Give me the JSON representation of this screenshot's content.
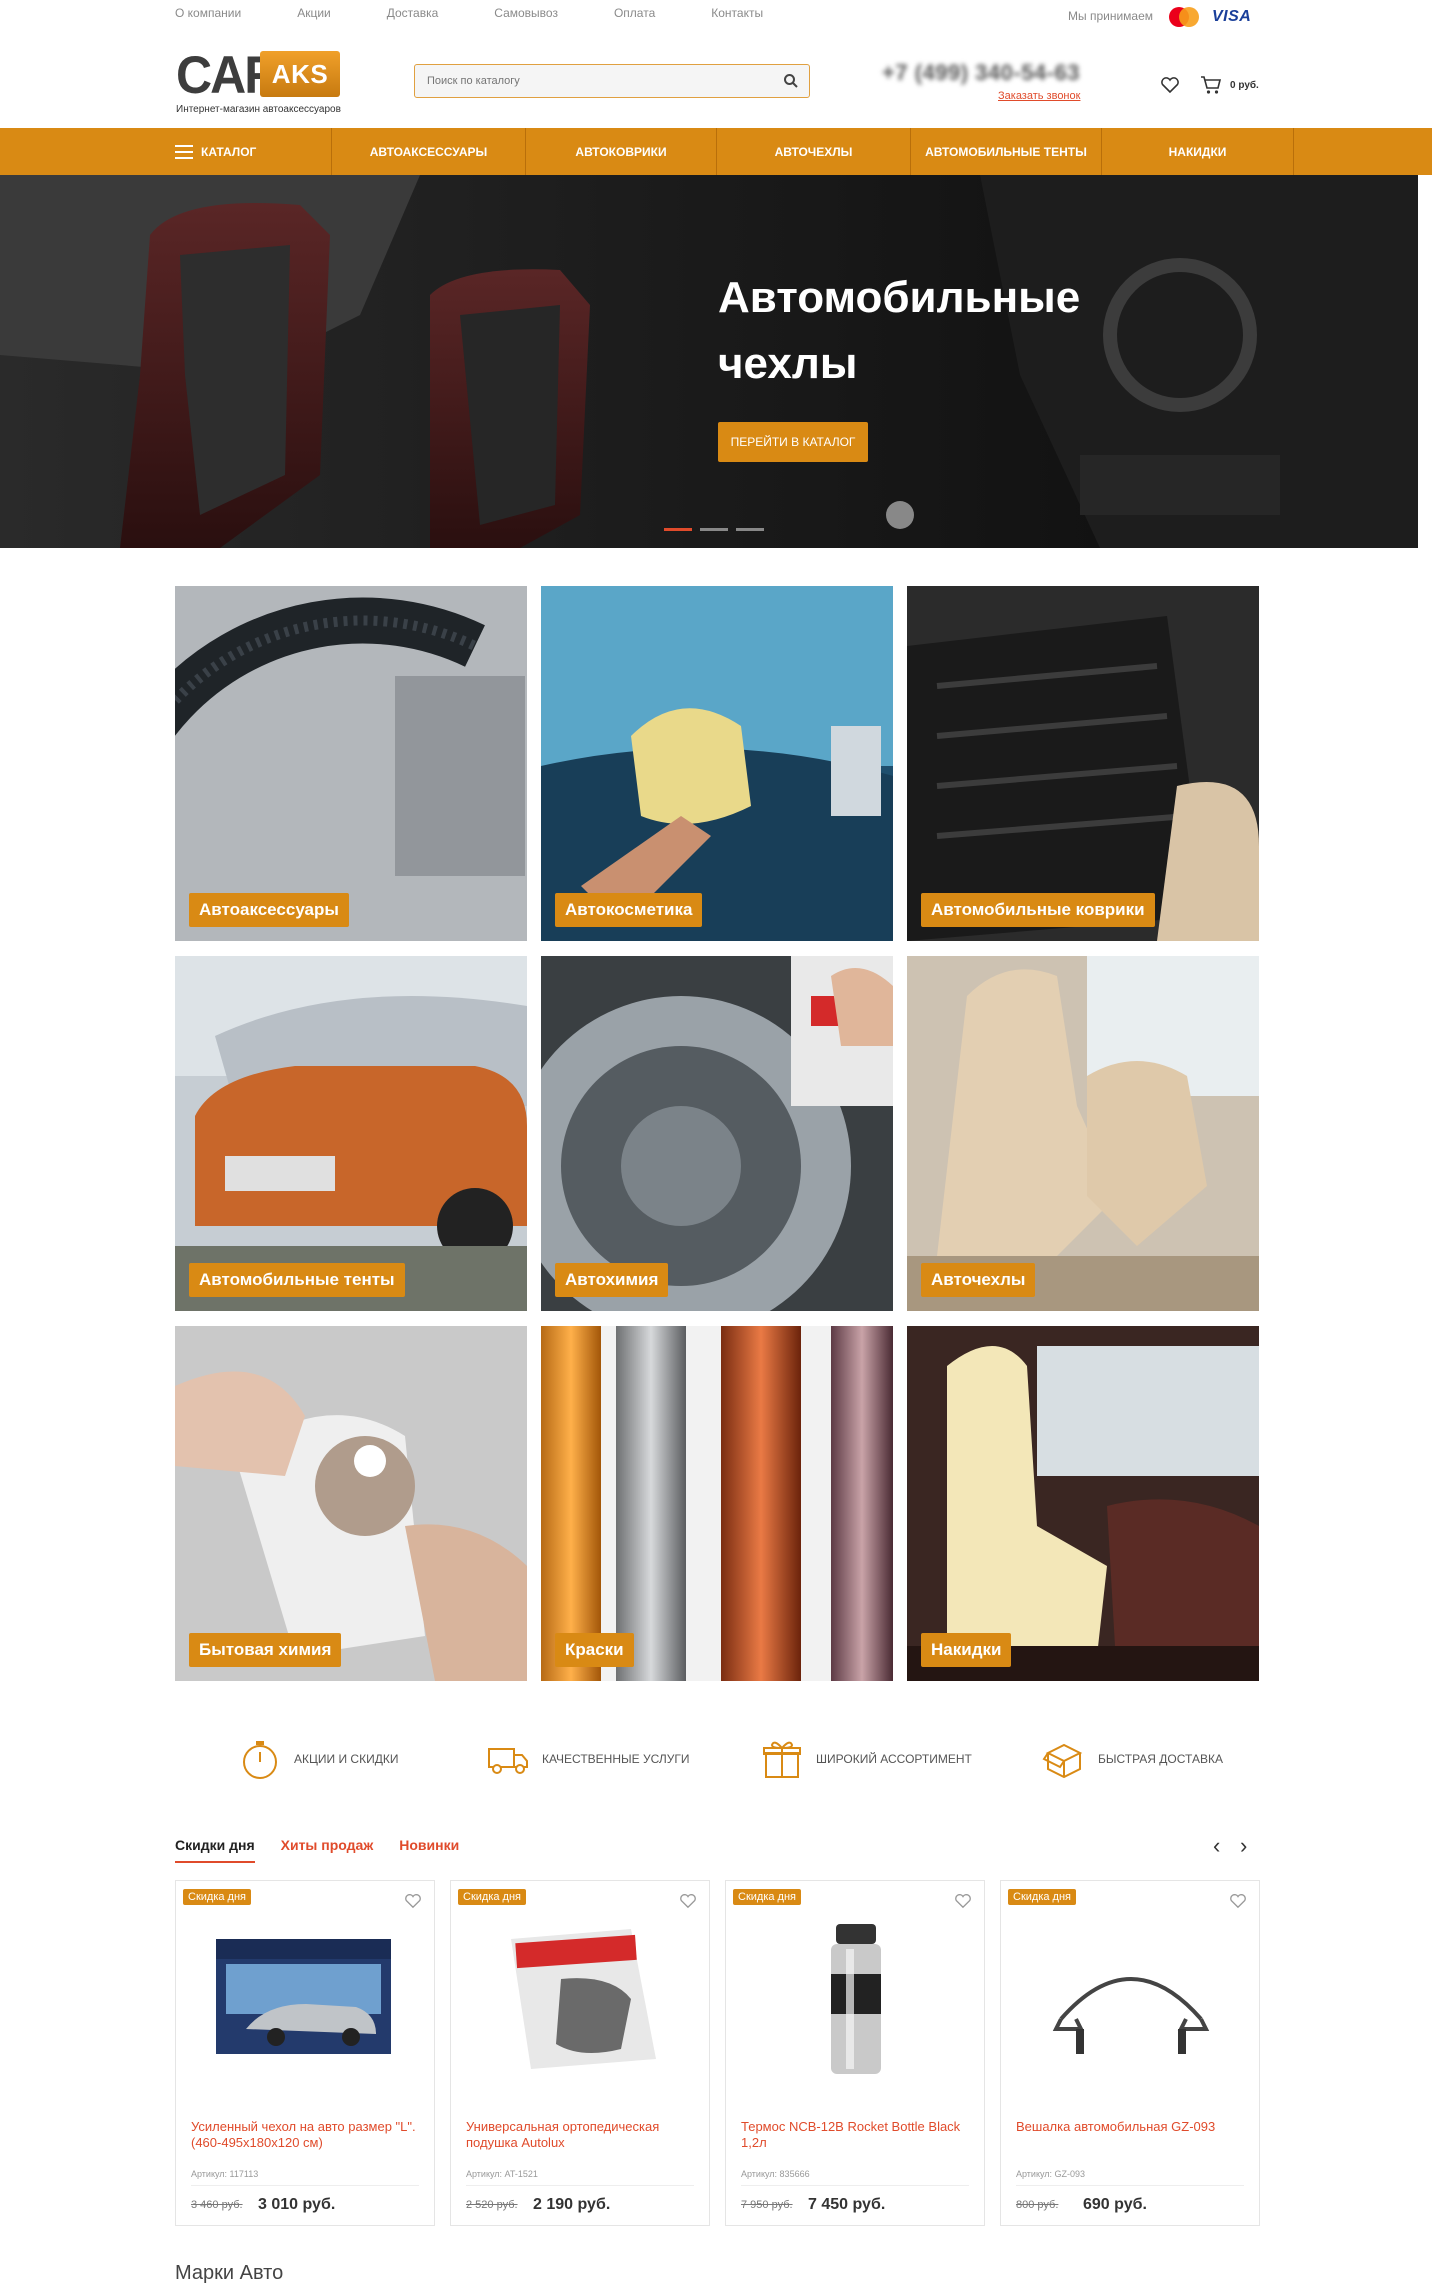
{
  "top_nav": [
    "О компании",
    "Акции",
    "Доставка",
    "Самовывоз",
    "Оплата",
    "Контакты"
  ],
  "payments": {
    "accept_label": "Мы принимаем",
    "visa": "VISA"
  },
  "logo": {
    "car": "CAR",
    "aks": "AKS",
    "subtitle": "Интернет-магазин автоаксессуаров"
  },
  "search": {
    "placeholder": "Поиск по каталогу"
  },
  "contact": {
    "phone": "+7 (499) 340-54-63",
    "callback": "Заказать звонок"
  },
  "cart": {
    "sum": "0 руб."
  },
  "main_nav": {
    "catalog": "Каталог",
    "items": [
      "Автоаксессуары",
      "Автоковрики",
      "Авточехлы",
      "Автомобильные тенты",
      "Накидки"
    ]
  },
  "hero": {
    "title": "Автомобильные чехлы",
    "button": "ПЕРЕЙТИ В КАТАЛОГ"
  },
  "categories": [
    "Автоаксессуары",
    "Автокосметика",
    "Автомобильные коврики",
    "Автомобильные тенты",
    "Автохимия",
    "Авточехлы",
    "Бытовая химия",
    "Краски",
    "Накидки"
  ],
  "features": [
    "Акции и скидки",
    "Качественные услуги",
    "Широкий ассортимент",
    "Быстрая доставка"
  ],
  "tabs": [
    "Скидки дня",
    "Хиты продаж",
    "Новинки"
  ],
  "products": [
    {
      "badge": "Скидка дня",
      "name": "Усиленный чехол на авто размер \"L\". (460-495х180х120 см)",
      "sku": "Артикул: 117113",
      "old_price": "3 460 руб.",
      "price": "3 010 руб."
    },
    {
      "badge": "Скидка дня",
      "name": "Универсальная ортопедическая подушка Autolux",
      "sku": "Артикул: AT-1521",
      "old_price": "2 520 руб.",
      "price": "2 190 руб."
    },
    {
      "badge": "Скидка дня",
      "name": "Термос NCB-12B Rocket Bottle Black 1,2л",
      "sku": "Артикул: 835666",
      "old_price": "7 950 руб.",
      "price": "7 450 руб."
    },
    {
      "badge": "Скидка дня",
      "name": "Вешалка автомобильная GZ-093",
      "sku": "Артикул: GZ-093",
      "old_price": "800 руб.",
      "price": "690 руб."
    }
  ],
  "brands_title": "Марки Авто",
  "colors": {
    "accent": "#d98a14",
    "link": "#e04b2b"
  }
}
